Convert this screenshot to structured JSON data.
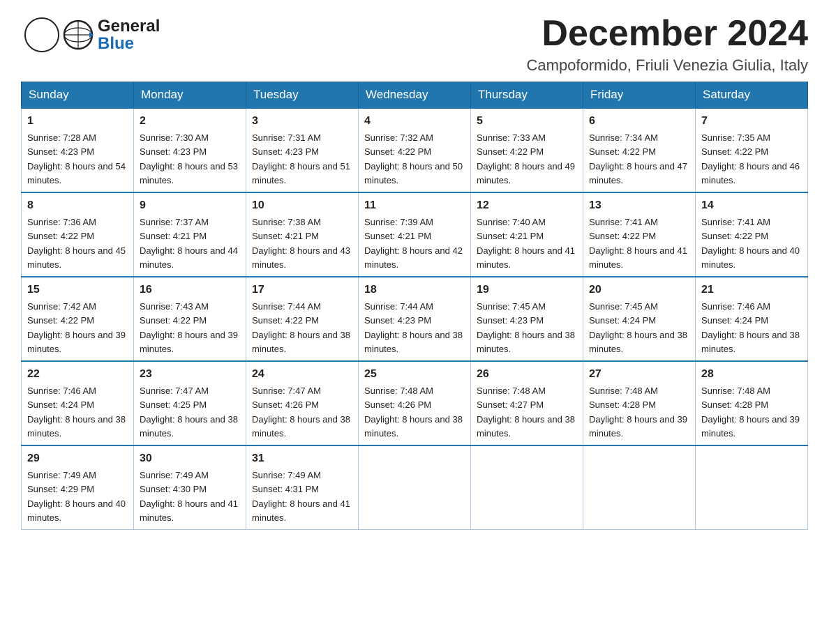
{
  "header": {
    "title": "December 2024",
    "subtitle": "Campoformido, Friuli Venezia Giulia, Italy",
    "logo_general": "General",
    "logo_blue": "Blue"
  },
  "days_of_week": [
    "Sunday",
    "Monday",
    "Tuesday",
    "Wednesday",
    "Thursday",
    "Friday",
    "Saturday"
  ],
  "weeks": [
    [
      {
        "day": "1",
        "sunrise": "7:28 AM",
        "sunset": "4:23 PM",
        "daylight": "8 hours and 54 minutes."
      },
      {
        "day": "2",
        "sunrise": "7:30 AM",
        "sunset": "4:23 PM",
        "daylight": "8 hours and 53 minutes."
      },
      {
        "day": "3",
        "sunrise": "7:31 AM",
        "sunset": "4:23 PM",
        "daylight": "8 hours and 51 minutes."
      },
      {
        "day": "4",
        "sunrise": "7:32 AM",
        "sunset": "4:22 PM",
        "daylight": "8 hours and 50 minutes."
      },
      {
        "day": "5",
        "sunrise": "7:33 AM",
        "sunset": "4:22 PM",
        "daylight": "8 hours and 49 minutes."
      },
      {
        "day": "6",
        "sunrise": "7:34 AM",
        "sunset": "4:22 PM",
        "daylight": "8 hours and 47 minutes."
      },
      {
        "day": "7",
        "sunrise": "7:35 AM",
        "sunset": "4:22 PM",
        "daylight": "8 hours and 46 minutes."
      }
    ],
    [
      {
        "day": "8",
        "sunrise": "7:36 AM",
        "sunset": "4:22 PM",
        "daylight": "8 hours and 45 minutes."
      },
      {
        "day": "9",
        "sunrise": "7:37 AM",
        "sunset": "4:21 PM",
        "daylight": "8 hours and 44 minutes."
      },
      {
        "day": "10",
        "sunrise": "7:38 AM",
        "sunset": "4:21 PM",
        "daylight": "8 hours and 43 minutes."
      },
      {
        "day": "11",
        "sunrise": "7:39 AM",
        "sunset": "4:21 PM",
        "daylight": "8 hours and 42 minutes."
      },
      {
        "day": "12",
        "sunrise": "7:40 AM",
        "sunset": "4:21 PM",
        "daylight": "8 hours and 41 minutes."
      },
      {
        "day": "13",
        "sunrise": "7:41 AM",
        "sunset": "4:22 PM",
        "daylight": "8 hours and 41 minutes."
      },
      {
        "day": "14",
        "sunrise": "7:41 AM",
        "sunset": "4:22 PM",
        "daylight": "8 hours and 40 minutes."
      }
    ],
    [
      {
        "day": "15",
        "sunrise": "7:42 AM",
        "sunset": "4:22 PM",
        "daylight": "8 hours and 39 minutes."
      },
      {
        "day": "16",
        "sunrise": "7:43 AM",
        "sunset": "4:22 PM",
        "daylight": "8 hours and 39 minutes."
      },
      {
        "day": "17",
        "sunrise": "7:44 AM",
        "sunset": "4:22 PM",
        "daylight": "8 hours and 38 minutes."
      },
      {
        "day": "18",
        "sunrise": "7:44 AM",
        "sunset": "4:23 PM",
        "daylight": "8 hours and 38 minutes."
      },
      {
        "day": "19",
        "sunrise": "7:45 AM",
        "sunset": "4:23 PM",
        "daylight": "8 hours and 38 minutes."
      },
      {
        "day": "20",
        "sunrise": "7:45 AM",
        "sunset": "4:24 PM",
        "daylight": "8 hours and 38 minutes."
      },
      {
        "day": "21",
        "sunrise": "7:46 AM",
        "sunset": "4:24 PM",
        "daylight": "8 hours and 38 minutes."
      }
    ],
    [
      {
        "day": "22",
        "sunrise": "7:46 AM",
        "sunset": "4:24 PM",
        "daylight": "8 hours and 38 minutes."
      },
      {
        "day": "23",
        "sunrise": "7:47 AM",
        "sunset": "4:25 PM",
        "daylight": "8 hours and 38 minutes."
      },
      {
        "day": "24",
        "sunrise": "7:47 AM",
        "sunset": "4:26 PM",
        "daylight": "8 hours and 38 minutes."
      },
      {
        "day": "25",
        "sunrise": "7:48 AM",
        "sunset": "4:26 PM",
        "daylight": "8 hours and 38 minutes."
      },
      {
        "day": "26",
        "sunrise": "7:48 AM",
        "sunset": "4:27 PM",
        "daylight": "8 hours and 38 minutes."
      },
      {
        "day": "27",
        "sunrise": "7:48 AM",
        "sunset": "4:28 PM",
        "daylight": "8 hours and 39 minutes."
      },
      {
        "day": "28",
        "sunrise": "7:48 AM",
        "sunset": "4:28 PM",
        "daylight": "8 hours and 39 minutes."
      }
    ],
    [
      {
        "day": "29",
        "sunrise": "7:49 AM",
        "sunset": "4:29 PM",
        "daylight": "8 hours and 40 minutes."
      },
      {
        "day": "30",
        "sunrise": "7:49 AM",
        "sunset": "4:30 PM",
        "daylight": "8 hours and 41 minutes."
      },
      {
        "day": "31",
        "sunrise": "7:49 AM",
        "sunset": "4:31 PM",
        "daylight": "8 hours and 41 minutes."
      },
      null,
      null,
      null,
      null
    ]
  ],
  "labels": {
    "sunrise": "Sunrise:",
    "sunset": "Sunset:",
    "daylight": "Daylight:"
  }
}
